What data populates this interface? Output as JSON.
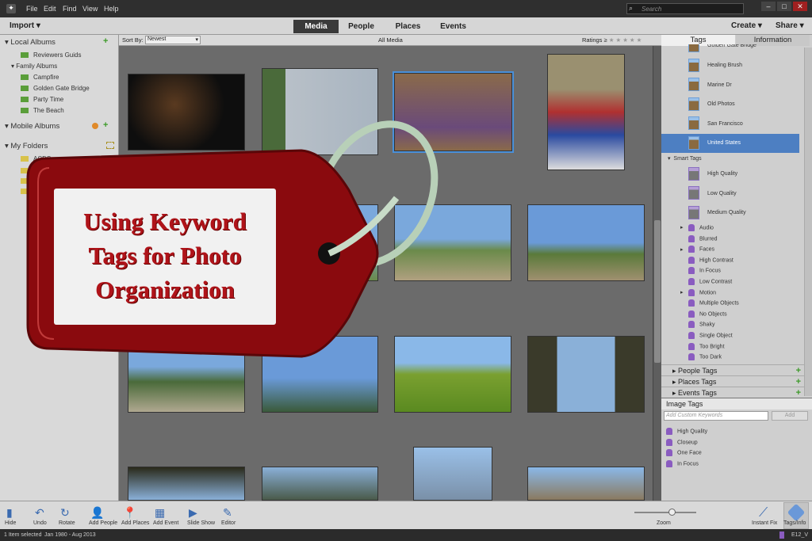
{
  "menu": {
    "items": [
      "File",
      "Edit",
      "Find",
      "View",
      "Help"
    ],
    "search_placeholder": "Search"
  },
  "window": {
    "min": "–",
    "max": "□",
    "close": "✕"
  },
  "topbar": {
    "import": "Import",
    "tabs": [
      "Media",
      "People",
      "Places",
      "Events"
    ],
    "active_tab": "Media",
    "create": "Create",
    "share": "Share"
  },
  "left": {
    "local_albums": "Local Albums",
    "albums": [
      "Reviewers Guids"
    ],
    "family_albums": "Family Albums",
    "family": [
      "Campfire",
      "Golden Gate Bridge",
      "Party Time",
      "The Beach"
    ],
    "mobile_albums": "Mobile Albums",
    "my_folders": "My Folders",
    "folders": [
      "ACDS"
    ]
  },
  "subbar": {
    "sort_label": "Sort By:",
    "sort_value": "Newest",
    "title": "All Media",
    "ratings_label": "Ratings",
    "ratings_op": "≥",
    "stars": "★★★★★"
  },
  "overlay": {
    "line1": "Using Keyword",
    "line2": "Tags for Photo",
    "line3": "Organization"
  },
  "right": {
    "tabs": [
      "Tags",
      "Information"
    ],
    "active_tab": "Tags",
    "place_tags": [
      "Golden Gate Bridge",
      "Healing Brush",
      "Marine Dr",
      "Old Photos",
      "San Francisco",
      "United States"
    ],
    "selected_tag": "United States",
    "smart_tags_label": "Smart Tags",
    "smart_photo_tags": [
      "High Quality",
      "Low Quality",
      "Medium Quality"
    ],
    "smart_tags": [
      {
        "label": "Audio",
        "expand": true
      },
      {
        "label": "Blurred"
      },
      {
        "label": "Faces",
        "expand": true
      },
      {
        "label": "High Contrast"
      },
      {
        "label": "In Focus"
      },
      {
        "label": "Low Contrast"
      },
      {
        "label": "Motion",
        "expand": true
      },
      {
        "label": "Multiple Objects"
      },
      {
        "label": "No Objects"
      },
      {
        "label": "Shaky"
      },
      {
        "label": "Single Object"
      },
      {
        "label": "Too Bright"
      },
      {
        "label": "Too Dark"
      }
    ],
    "groups": [
      "People Tags",
      "Places Tags",
      "Events Tags"
    ],
    "image_tags_label": "Image Tags",
    "keyword_placeholder": "Add Custom Keywords",
    "add_label": "Add",
    "image_tags": [
      "High Quality",
      "Closeup",
      "One Face",
      "In Focus"
    ]
  },
  "bottom": {
    "buttons": [
      "Hide",
      "Undo",
      "Rotate",
      "Add People",
      "Add Places",
      "Add Event",
      "Slide Show",
      "Editor"
    ],
    "zoom": "Zoom",
    "zoom_level": 0.6,
    "instant_fix": "Instant Fix",
    "tags_info": "Tags/Info"
  },
  "status": {
    "selected": "1 Item selected",
    "range": "Jan 1980 - Aug 2013",
    "catalog": "E12_V"
  },
  "colors": {
    "accent": "#4d7fc2",
    "tag_red": "#8a0a0e",
    "tag_text": "#b0141a",
    "add_green": "#3c9a28"
  }
}
